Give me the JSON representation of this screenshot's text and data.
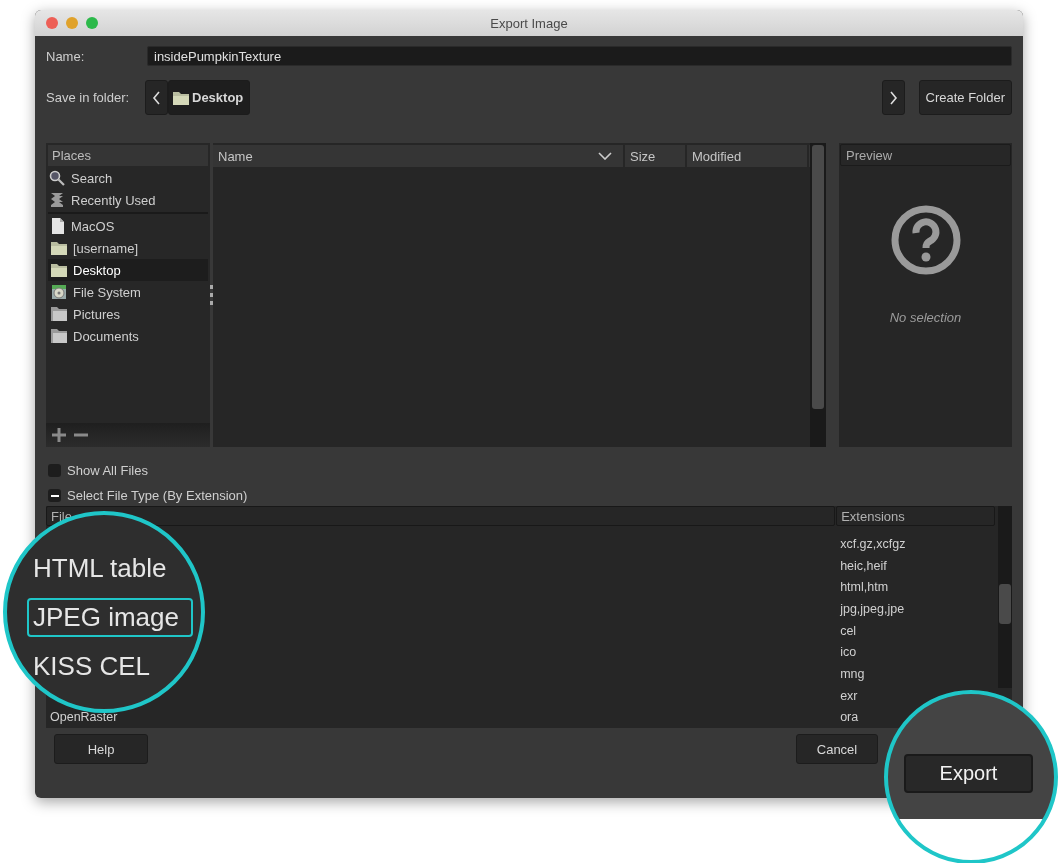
{
  "window": {
    "title": "Export Image"
  },
  "name_field": {
    "label": "Name:",
    "value": "insidePumpkinTexture"
  },
  "save_in": {
    "label": "Save in folder:",
    "path": [
      {
        "label": "Desktop",
        "selected": true
      }
    ],
    "create_folder": "Create Folder"
  },
  "places": {
    "title": "Places",
    "sections": [
      {
        "items": [
          {
            "kind": "search",
            "label": "Search",
            "selected": false
          },
          {
            "kind": "recent",
            "label": "Recently Used",
            "selected": false
          }
        ]
      },
      {
        "items": [
          {
            "kind": "drive",
            "label": "MacOS",
            "selected": false
          },
          {
            "kind": "home",
            "label": "[username]",
            "selected": false
          },
          {
            "kind": "home",
            "label": "Desktop",
            "selected": true
          },
          {
            "kind": "filesystem",
            "label": "File System",
            "selected": false
          },
          {
            "kind": "folder",
            "label": "Pictures",
            "selected": false
          },
          {
            "kind": "folder",
            "label": "Documents",
            "selected": false
          }
        ]
      }
    ]
  },
  "files": {
    "columns": [
      "Name",
      "Size",
      "Modified"
    ]
  },
  "preview": {
    "title": "Preview",
    "message": "No selection"
  },
  "show_all_files": {
    "label": "Show All Files",
    "checked": false
  },
  "file_type": {
    "label": "Select File Type (By Extension)",
    "expanded": true,
    "columns": [
      "File",
      "Extensions"
    ],
    "rows": [
      {
        "extensions": "xcf.gz,xcfgz"
      },
      {
        "extensions": "heic,heif"
      },
      {
        "extensions": "html,htm"
      },
      {
        "extensions": "jpg,jpeg,jpe"
      },
      {
        "extensions": "cel"
      },
      {
        "extensions": "ico"
      },
      {
        "extensions": "mng"
      },
      {
        "extensions": "exr"
      },
      {
        "name": "OpenRaster",
        "extensions": "ora"
      }
    ]
  },
  "buttons": [
    {
      "label": "Help"
    },
    {
      "label": "Cancel"
    }
  ],
  "magnifier_list": [
    {
      "label": "HTML table",
      "selected": false
    },
    {
      "label": "JPEG image",
      "selected": true
    },
    {
      "label": "KISS CEL",
      "selected": false
    }
  ],
  "magnifier_button": {
    "label": "Export"
  }
}
